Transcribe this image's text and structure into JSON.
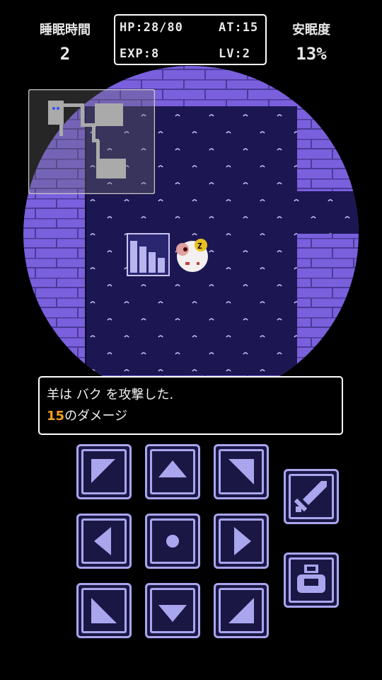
{
  "hud": {
    "sleep_time_label": "睡眠時間",
    "sleep_time_value": "2",
    "hp": "HP:28/80",
    "at": "AT:15",
    "exp": "EXP:8",
    "lv": "LV:2",
    "comfort_label": "安眠度",
    "comfort_value": "13%"
  },
  "message": {
    "line1": "羊は バク を攻撃した.",
    "damage_value": "15",
    "line2_suffix": "のダメージ"
  },
  "controls": {
    "dpad": [
      "move-up-left",
      "move-up",
      "move-up-right",
      "move-left",
      "wait",
      "move-right",
      "move-down-left",
      "move-down",
      "move-down-right"
    ],
    "attack_icon": "sword-icon",
    "item_icon": "bag-icon"
  },
  "colors": {
    "floor": "#1c1652",
    "wall": "#7a60dd",
    "wall_dark": "#5a44b8",
    "button": "#a9a6ee",
    "damage": "#f0a020"
  }
}
